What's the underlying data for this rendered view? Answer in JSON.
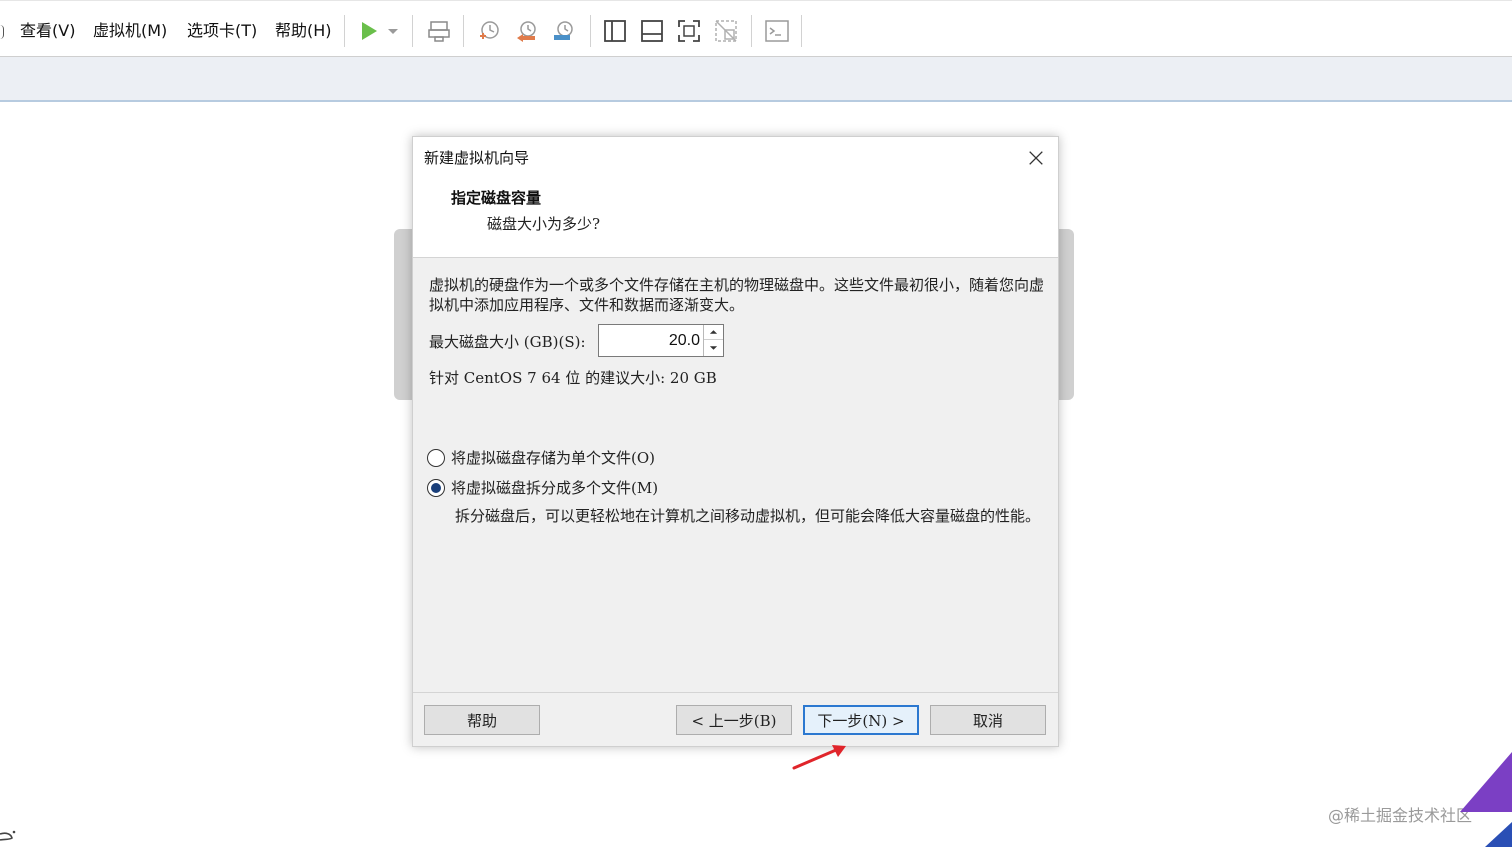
{
  "menu": {
    "items": [
      "查看(V)",
      "虚拟机(M)",
      "选项卡(T)",
      "帮助(H)"
    ]
  },
  "toolbar": {
    "icons": [
      "play-icon",
      "dropdown-chevron-icon",
      "send-keys-icon",
      "snapshot-icon",
      "revert-snapshot-icon",
      "snapshot-manager-icon",
      "sidebar-view-icon",
      "thumbnail-bar-icon",
      "fullscreen-icon",
      "unity-icon",
      "console-icon"
    ],
    "accent": "#6abf4b"
  },
  "dialog": {
    "title": "新建虚拟机向导",
    "step_title": "指定磁盘容量",
    "step_subtitle": "磁盘大小为多少?",
    "description": "虚拟机的硬盘作为一个或多个文件存储在主机的物理磁盘中。这些文件最初很小，随着您向虚拟机中添加应用程序、文件和数据而逐渐变大。",
    "max_size_label": "最大磁盘大小 (GB)(S):",
    "max_size_value": "20.0",
    "recommendation": "针对 CentOS 7 64 位 的建议大小: 20 GB",
    "options": [
      {
        "label": "将虚拟磁盘存储为单个文件(O)",
        "selected": false
      },
      {
        "label": "将虚拟磁盘拆分成多个文件(M)",
        "selected": true
      }
    ],
    "split_note": "拆分磁盘后，可以更轻松地在计算机之间移动虚拟机，但可能会降低大容量磁盘的性能。",
    "buttons": {
      "help": "帮助",
      "back": "< 上一步(B)",
      "next": "下一步(N) >",
      "cancel": "取消"
    },
    "primary_color": "#2b78d0"
  },
  "watermark": "@稀土掘金技术社区"
}
